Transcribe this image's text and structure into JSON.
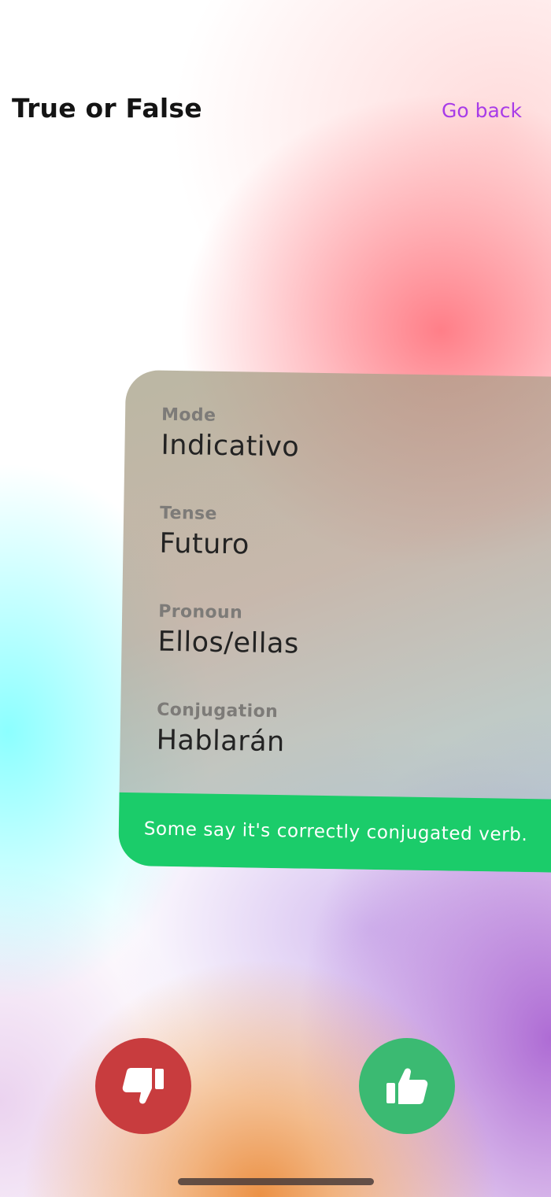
{
  "header": {
    "title": "True or False",
    "go_back_label": "Go back"
  },
  "card": {
    "fields": [
      {
        "label": "Mode",
        "value": "Indicativo"
      },
      {
        "label": "Tense",
        "value": "Futuro"
      },
      {
        "label": "Pronoun",
        "value": "Ellos/ellas"
      },
      {
        "label": "Conjugation",
        "value": "Hablarán"
      }
    ],
    "footer_text": "Some say it's correctly conjugated verb."
  },
  "actions": {
    "false_icon": "thumbs-down-icon",
    "true_icon": "thumbs-up-icon"
  },
  "colors": {
    "accent": "#a83ce8",
    "false_button": "#c83c3e",
    "true_button": "#3bba72",
    "footer_bar": "#1bcc6a"
  }
}
